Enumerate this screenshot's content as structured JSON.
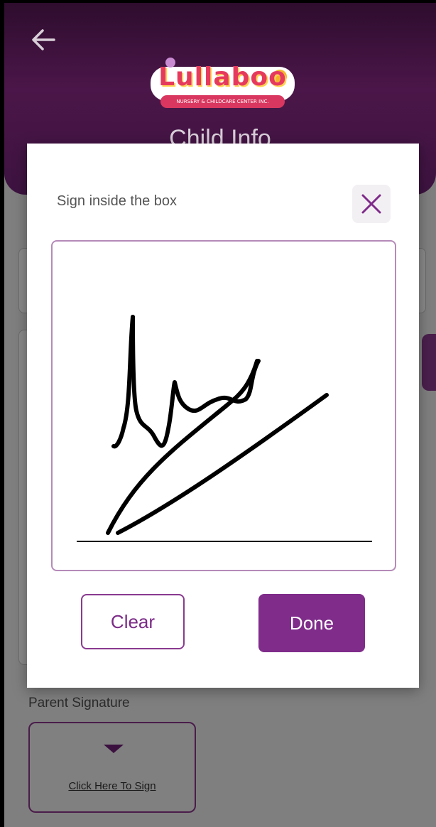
{
  "header": {
    "title": "Child Info",
    "logo": {
      "name": "Lullaboo",
      "tagline": "NURSERY & CHILDCARE CENTER INC."
    },
    "back_icon": "arrow-left-icon"
  },
  "modal": {
    "title": "Sign inside the box",
    "close_icon": "close-x-icon",
    "clear_label": "Clear",
    "done_label": "Done"
  },
  "signature_section": {
    "label": "Parent Signature",
    "link_text": "Click Here To Sign",
    "icon": "caret-down-icon"
  },
  "colors": {
    "header_bg": "#4b1649",
    "accent": "#7f2c8a",
    "pad_border": "#b58ab8",
    "overlay": "#7f7f7f"
  }
}
